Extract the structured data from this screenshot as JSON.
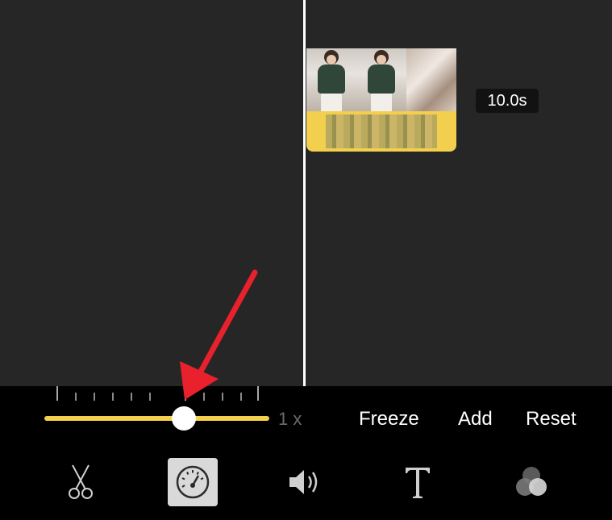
{
  "clip": {
    "duration": "10.0s"
  },
  "speed": {
    "label": "1 x",
    "slider_fraction": 0.6
  },
  "actions": [
    {
      "label": "Freeze"
    },
    {
      "label": "Add"
    },
    {
      "label": "Reset"
    }
  ],
  "tools": [
    {
      "name": "scissors-icon"
    },
    {
      "name": "speedometer-icon",
      "selected": true
    },
    {
      "name": "speaker-icon"
    },
    {
      "name": "text-icon"
    },
    {
      "name": "filters-icon"
    }
  ],
  "colors": {
    "accent": "#f3cf4e",
    "annotation_arrow": "#e8212c"
  }
}
